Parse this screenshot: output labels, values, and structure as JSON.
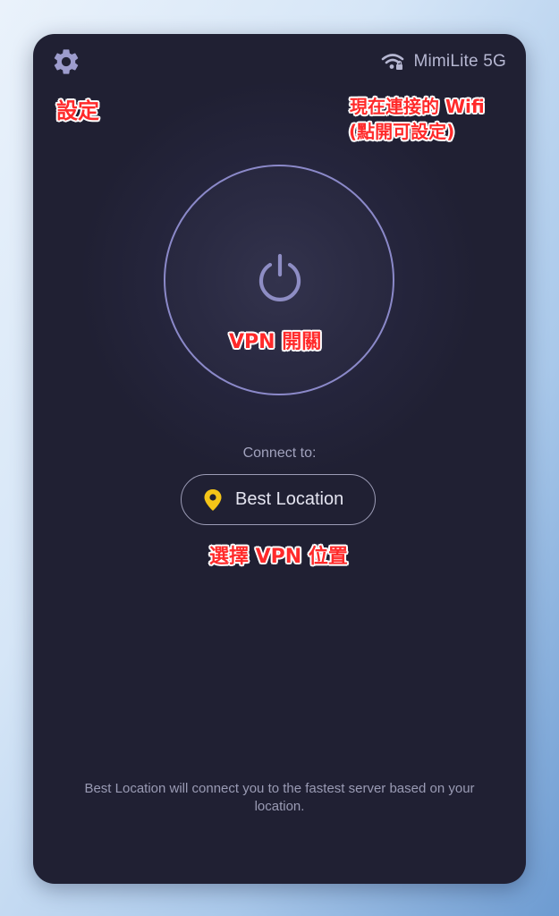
{
  "header": {
    "settings_icon": "gear-icon",
    "wifi_icon": "wifi-lock-icon",
    "wifi_name": "MimiLite 5G"
  },
  "vpn": {
    "power_icon": "power-icon",
    "connect_label": "Connect to:",
    "location_icon": "map-pin-icon",
    "location_label": "Best Location",
    "footer_note": "Best Location will connect you to the fastest server based on your location."
  },
  "annotations": {
    "settings": "設定",
    "wifi_line1": "現在連接的 Wifi",
    "wifi_line2": "(點開可設定)",
    "vpn_switch": "VPN 開關",
    "select_location": "選擇 VPN 位置"
  },
  "colors": {
    "panel_bg": "#202033",
    "ring": "#8b89c9",
    "icon": "#9d9ccd",
    "pin": "#f5c518",
    "annotation": "#ff2a2a"
  }
}
